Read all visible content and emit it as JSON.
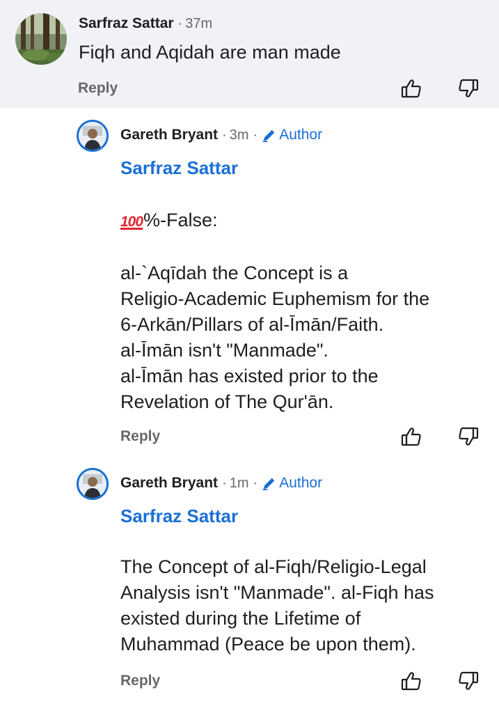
{
  "parent_comment": {
    "author": "Sarfraz Sattar",
    "time": "37m",
    "separator": "·",
    "text": "Fiqh and Aqidah are man made",
    "reply_label": "Reply"
  },
  "replies": [
    {
      "author": "Gareth Bryant",
      "time": "3m",
      "separator": "·",
      "badge": "Author",
      "mention": "Sarfraz Sattar",
      "emoji": "100",
      "first_line_rest": "%-False:",
      "lines": [
        "al-`Aqīdah the Concept is a",
        "Religio-Academic Euphemism for the",
        "6-Arkān/Pillars of al-Īmān/Faith.",
        "al-Īmān isn't \"Manmade\".",
        "al-Īmān has existed prior to the",
        "Revelation of The Qur'ān."
      ],
      "reply_label": "Reply"
    },
    {
      "author": "Gareth Bryant",
      "time": "1m",
      "separator": "·",
      "badge": "Author",
      "mention": "Sarfraz Sattar",
      "lines": [
        "The Concept of al-Fiqh/Religio-Legal",
        "Analysis isn't \"Manmade\". al-Fiqh has",
        "existed during the Lifetime of",
        "Muhammad (Peace be upon them)."
      ],
      "reply_label": "Reply"
    }
  ],
  "icons": {
    "like": "thumbs-up-icon",
    "dislike": "thumbs-down-icon",
    "author_badge": "pencil-icon"
  },
  "colors": {
    "link_blue": "#1a6fd6",
    "parent_background": "#f0f2f5",
    "muted_text": "#65676b",
    "emoji_red": "#e0262e"
  }
}
